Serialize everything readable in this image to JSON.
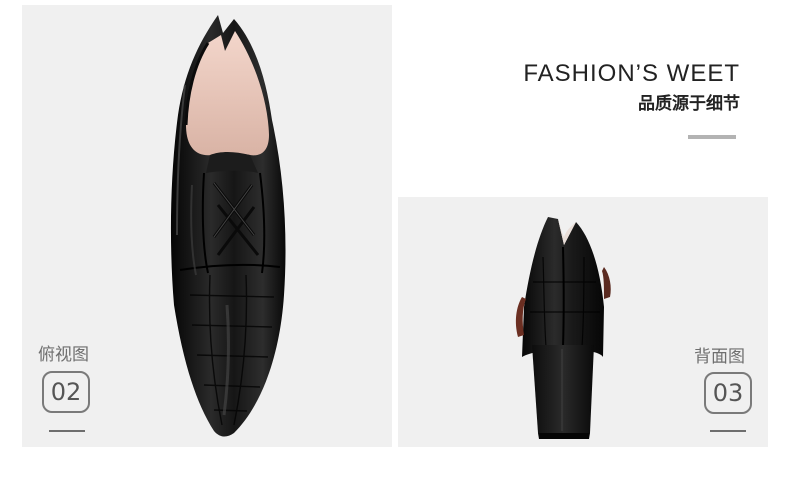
{
  "header": {
    "title": "FASHION’S WEET",
    "subtitle": "品质源于细节"
  },
  "views": [
    {
      "label": "俯视图",
      "number": "02",
      "image": "shoe-top-view"
    },
    {
      "label": "背面图",
      "number": "03",
      "image": "shoe-back-view"
    }
  ],
  "colors": {
    "panel_background": "#f0f0f0",
    "accent_rule": "#b3b3b3",
    "label_gray": "#6e6e6e",
    "shoe_leather": "#111111",
    "shoe_lining": "#ebc9bd"
  }
}
